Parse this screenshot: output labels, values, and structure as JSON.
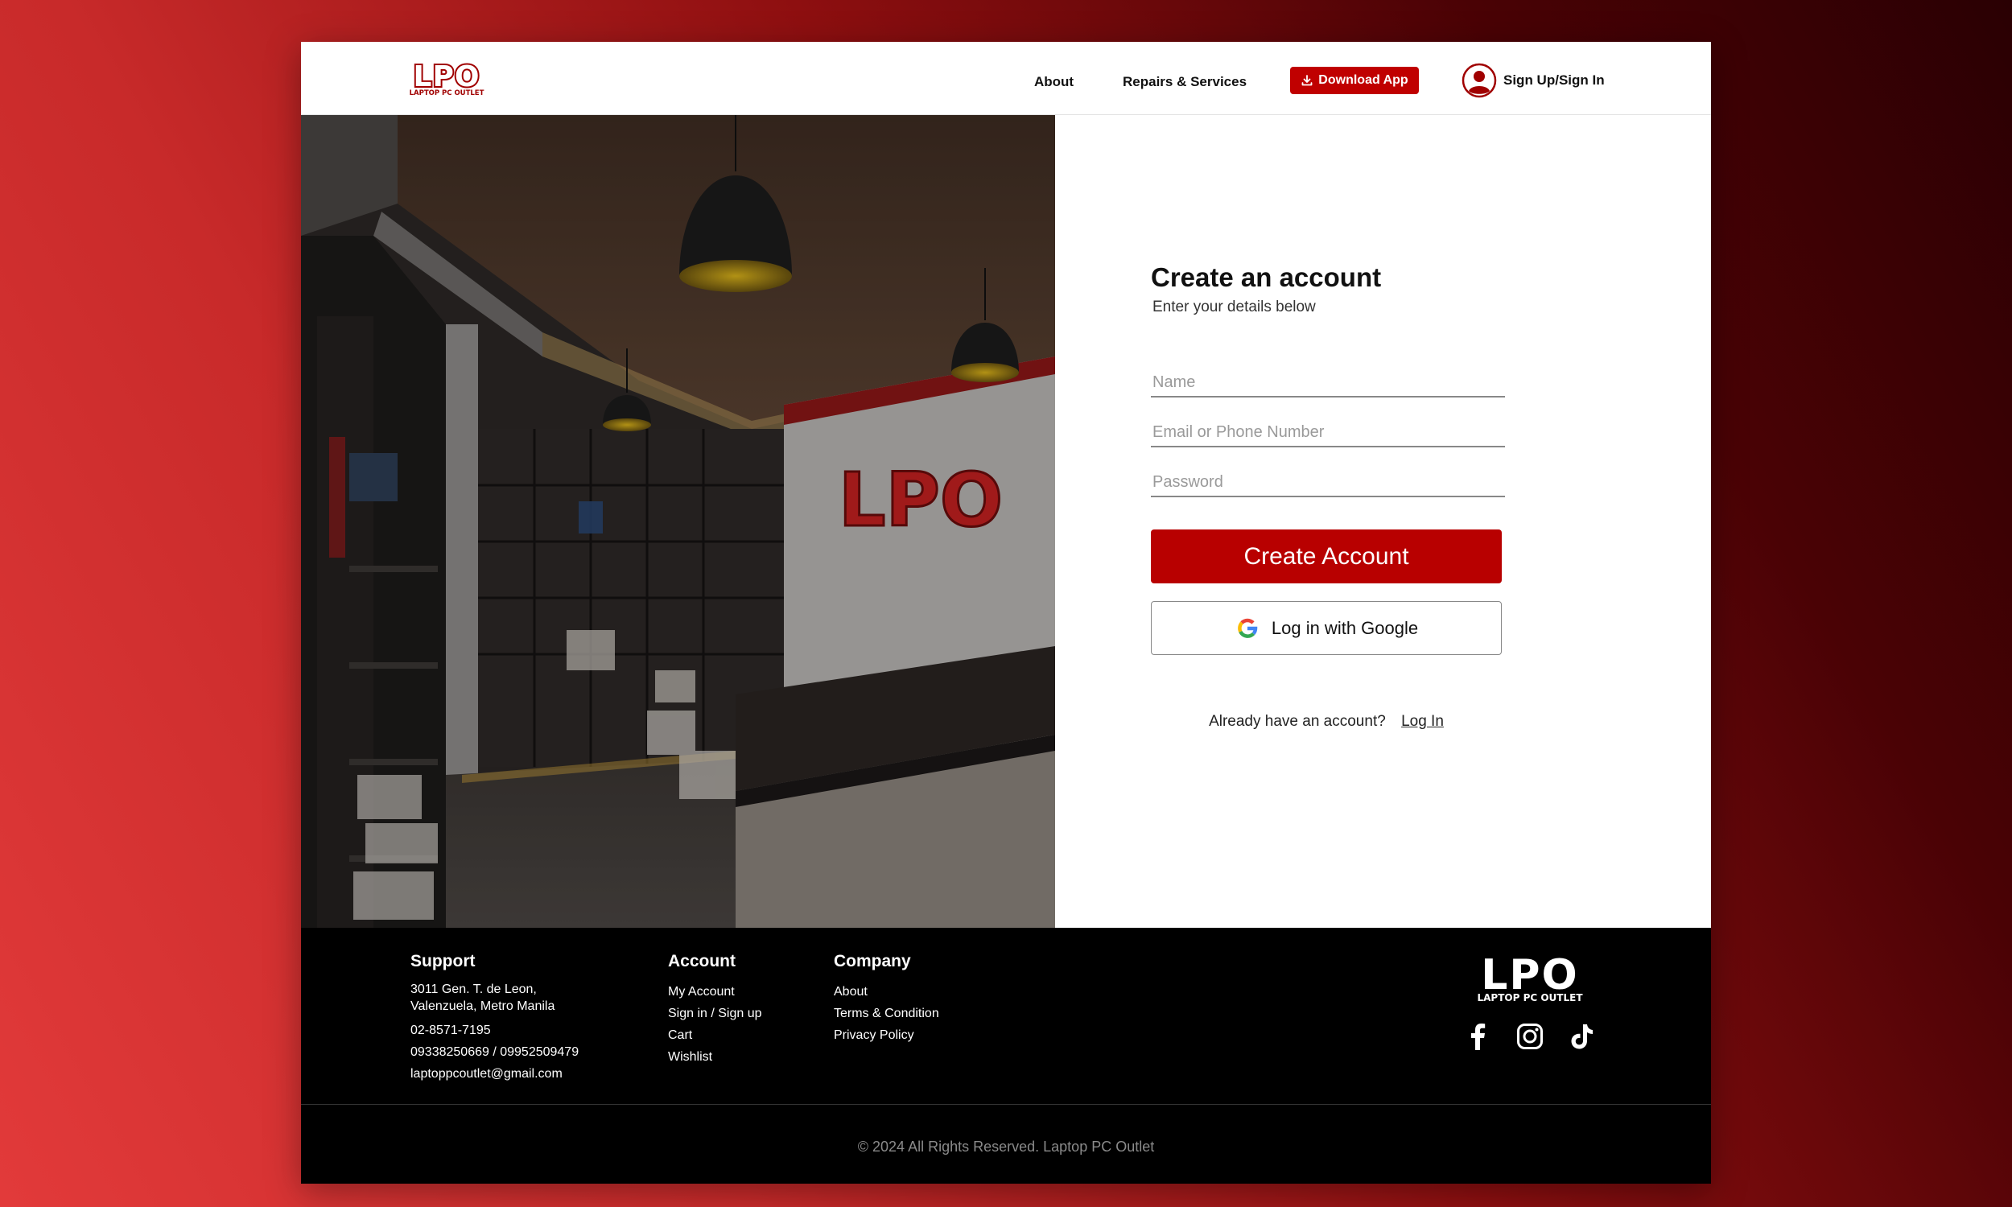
{
  "header": {
    "logo_text": "LPO",
    "logo_subtext": "LAPTOP PC OUTLET",
    "nav": {
      "about": "About",
      "repairs": "Repairs & Services"
    },
    "download_label": "Download App",
    "signin_label": "Sign Up/Sign In"
  },
  "hero": {
    "wall_logo_text": "LPO"
  },
  "form": {
    "title": "Create an account",
    "subtitle": "Enter your details below",
    "name_placeholder": "Name",
    "email_placeholder": "Email or Phone Number",
    "password_placeholder": "Password",
    "create_label": "Create Account",
    "google_label": "Log in with Google",
    "already_text": "Already have an account?",
    "login_link": "Log In"
  },
  "footer": {
    "support": {
      "heading": "Support",
      "address_line1": "3011 Gen. T. de Leon,",
      "address_line2": "Valenzuela, Metro Manila",
      "phone1": "02-8571-7195",
      "phone2": "09338250669 / 09952509479",
      "email": "laptoppcoutlet@gmail.com"
    },
    "account": {
      "heading": "Account",
      "items": [
        "My Account",
        "Sign in / Sign up",
        "Cart",
        "Wishlist"
      ]
    },
    "company": {
      "heading": "Company",
      "items": [
        "About",
        "Terms & Condition",
        "Privacy Policy"
      ]
    },
    "logo_text": "LPO",
    "logo_subtext": "LAPTOP PC OUTLET",
    "social_icons": [
      "facebook-icon",
      "instagram-icon",
      "tiktok-icon"
    ],
    "copyright": "© 2024 All Rights Reserved. Laptop PC Outlet"
  },
  "colors": {
    "brand_red": "#c00000",
    "button_red": "#b80000",
    "footer_bg": "#000000"
  }
}
